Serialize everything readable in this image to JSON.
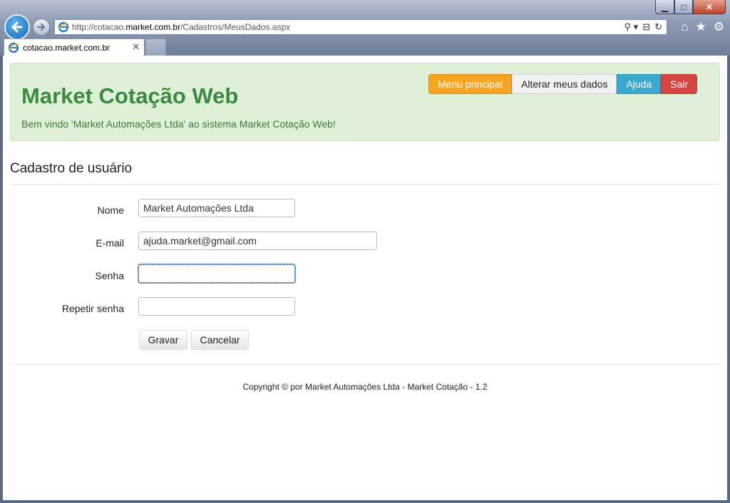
{
  "browser": {
    "url_prefix": "http://cotacao.",
    "url_host": "market.com.br",
    "url_path": "/Cadastros/MeusDados.aspx",
    "tab_title": "cotacao.market.com.br",
    "tab_close": "✕",
    "search_symbol": "⚲ ▾",
    "compat_symbol": "⊟",
    "refresh_symbol": "↻",
    "home_symbol": "⌂",
    "favorites_symbol": "★",
    "tools_symbol": "⚙",
    "min_symbol": "▁",
    "max_symbol": "□",
    "close_symbol": "✕"
  },
  "hero": {
    "title": "Market Cotação Web",
    "welcome": "Bem vindo 'Market Automações Ltda' ao sistema Market Cotação Web!"
  },
  "nav": {
    "menu_principal": "Menu principal",
    "alterar_dados": "Alterar meus dados",
    "ajuda": "Ajuda",
    "sair": "Sair"
  },
  "page": {
    "section_title": "Cadastro de usuário"
  },
  "form": {
    "nome_label": "Nome",
    "nome_value": "Market Automações Ltda",
    "email_label": "E-mail",
    "email_value": "ajuda.market@gmail.com",
    "senha_label": "Senha",
    "senha_value": "",
    "repetir_label": "Repetir senha",
    "repetir_value": "",
    "gravar": "Gravar",
    "cancelar": "Cancelar"
  },
  "footer": {
    "copyright": "Copyright © por Market Automações Ltda - Market Cotação - 1.2"
  },
  "colors": {
    "hero_bg": "#dff0d8",
    "hero_title": "#3c8a3f",
    "menu_btn": "#f7a520",
    "help_btn": "#3aa9cf",
    "exit_btn": "#d84440"
  }
}
